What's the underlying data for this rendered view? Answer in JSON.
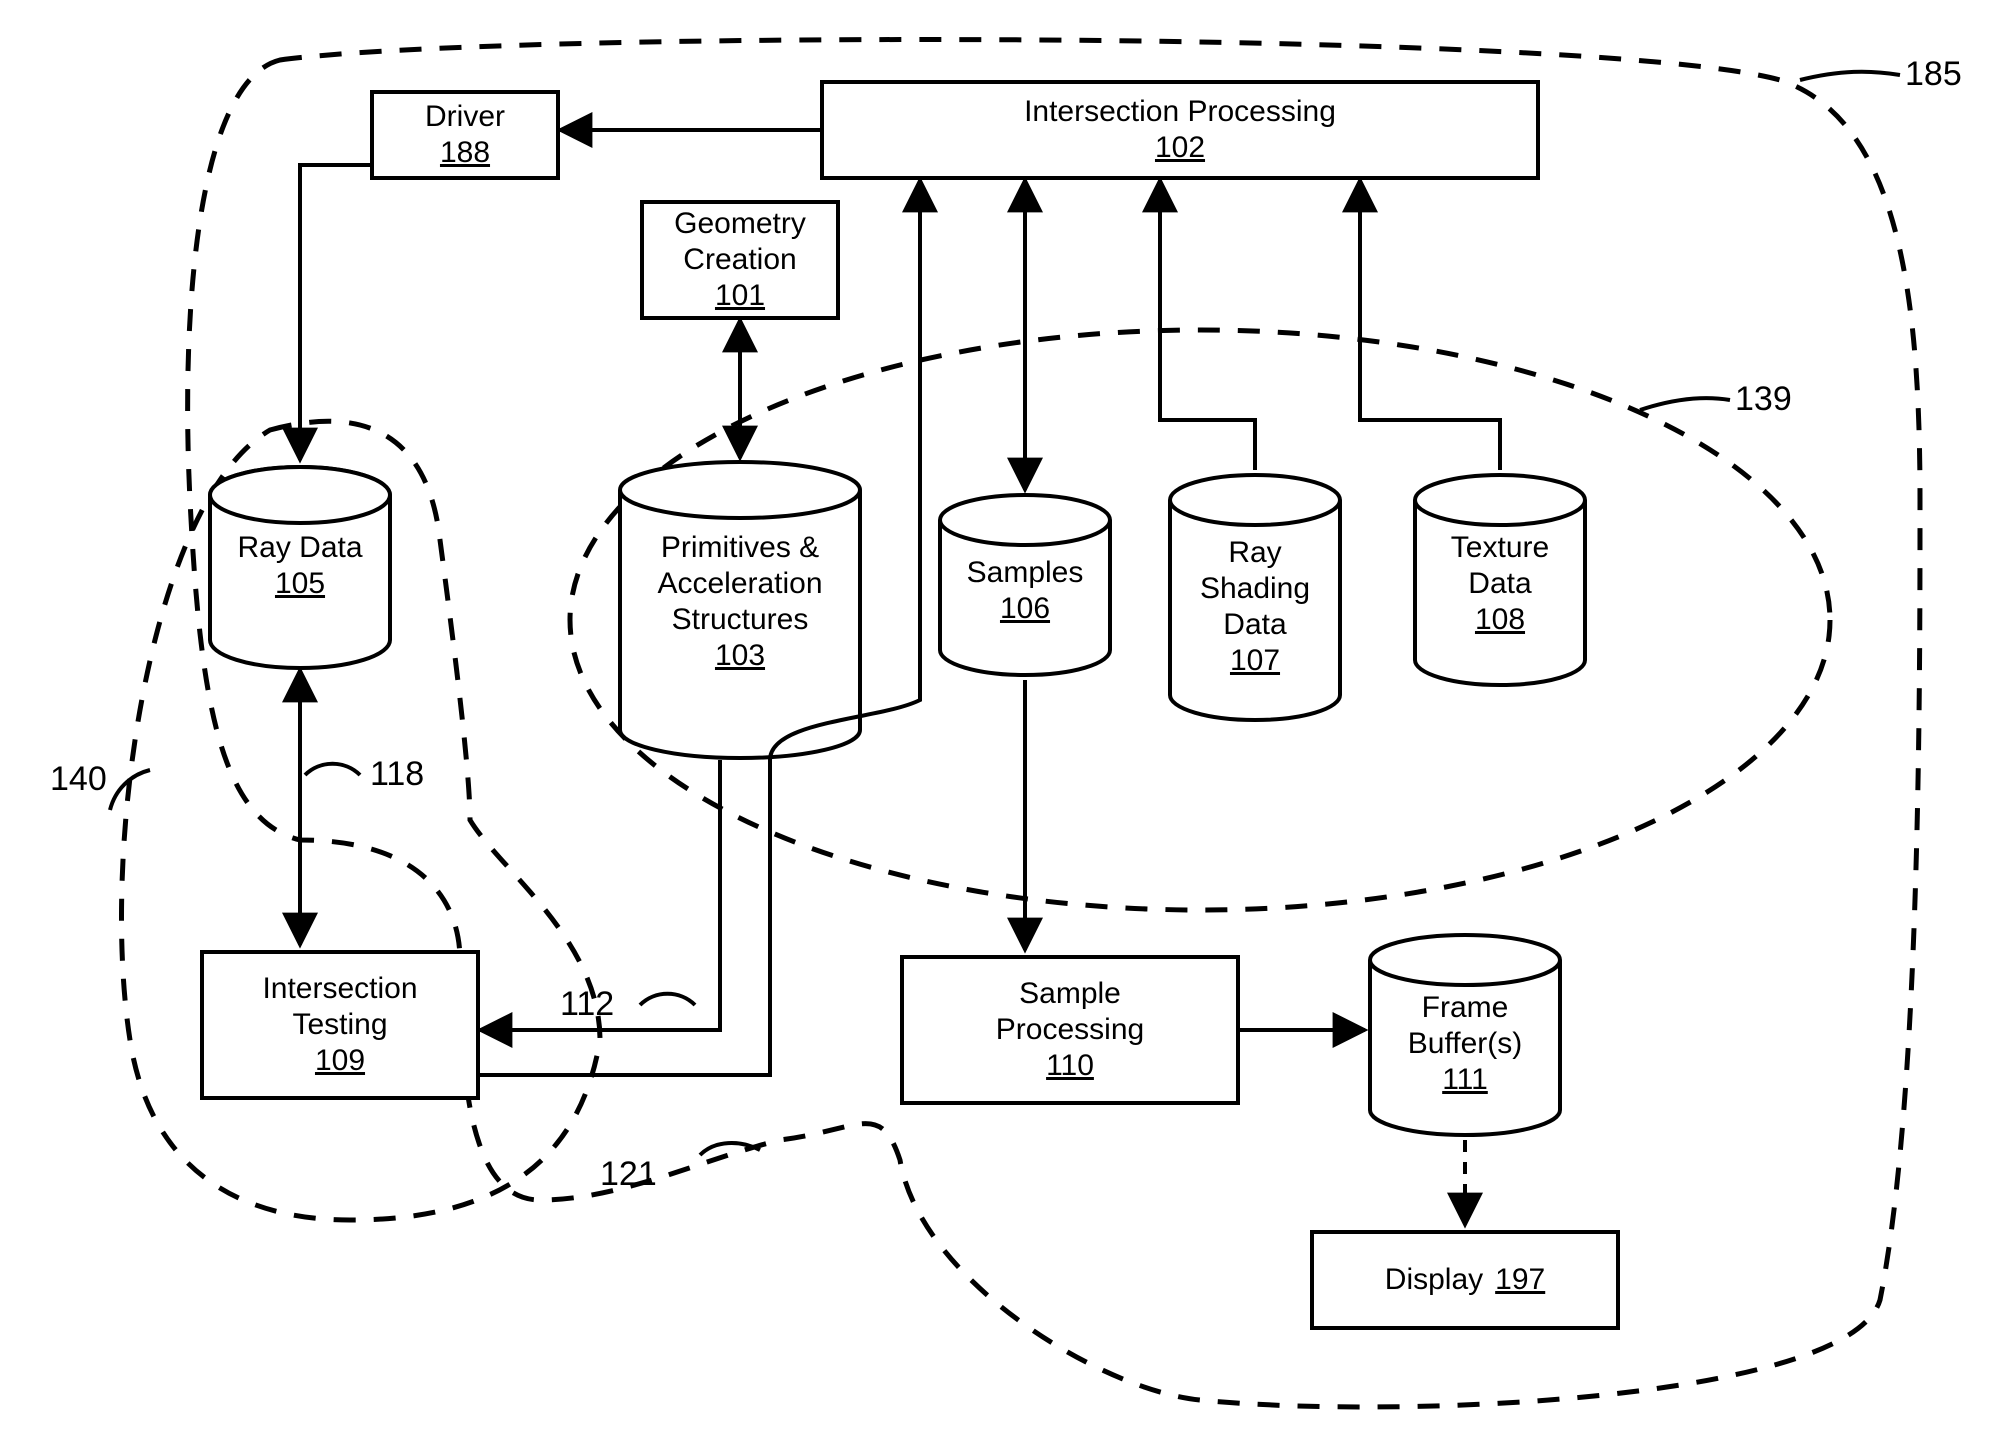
{
  "nodes": {
    "driver": {
      "label": "Driver",
      "ref": "188"
    },
    "intersectionProc": {
      "label": "Intersection Processing",
      "ref": "102"
    },
    "geomCreation": {
      "label": "Geometry\nCreation",
      "ref": "101"
    },
    "rayData": {
      "label": "Ray Data",
      "ref": "105"
    },
    "primAccel": {
      "label": "Primitives &\nAcceleration\nStructures",
      "ref": "103"
    },
    "samples": {
      "label": "Samples",
      "ref": "106"
    },
    "rayShading": {
      "label": "Ray\nShading\nData",
      "ref": "107"
    },
    "textureData": {
      "label": "Texture\nData",
      "ref": "108"
    },
    "intersectTest": {
      "label": "Intersection\nTesting",
      "ref": "109"
    },
    "sampleProc": {
      "label": "Sample\nProcessing",
      "ref": "110"
    },
    "frameBuffer": {
      "label": "Frame\nBuffer(s)",
      "ref": "111"
    },
    "display": {
      "label": "Display",
      "ref": "197"
    }
  },
  "refs": {
    "outerBoundary": "185",
    "innerBoundary": "139",
    "leftBoundary": "140",
    "edge118": "118",
    "edge112": "112",
    "edge121": "121"
  }
}
